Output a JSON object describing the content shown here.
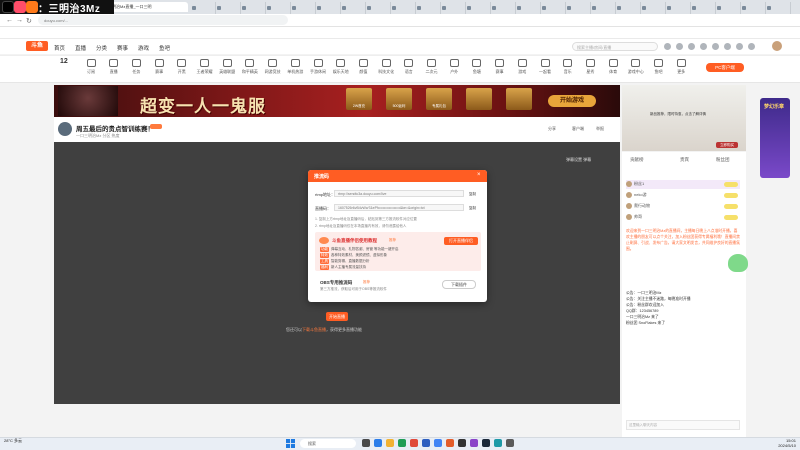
{
  "overlay": {
    "text": "：三明治3Mz"
  },
  "browser": {
    "tabs": [
      "",
      "",
      "",
      "",
      "",
      "",
      "",
      "",
      "",
      "",
      "",
      "",
      "",
      "",
      "",
      "",
      "",
      "",
      "",
      "",
      "",
      "",
      "",
      "",
      "",
      ""
    ],
    "active_tab": "一口三明治Mz直播_一口三明",
    "url": "douyu.com/..."
  },
  "site": {
    "logo": "斗鱼",
    "nav": [
      "首页",
      "直播",
      "分类",
      "赛事",
      "游戏",
      "鱼吧"
    ],
    "search_placeholder": "搜索主播/房间/直播",
    "categories": [
      "订阅",
      "直播",
      "任务",
      "赛事",
      "开黑",
      "王者荣耀",
      "英雄联盟",
      "和平精英",
      "网游竞技",
      "单机热游",
      "手游休闲",
      "娱乐天地",
      "颜值",
      "科技文化",
      "语言",
      "二次元",
      "户外",
      "鱼塘",
      "赛事",
      "游戏",
      "一起看",
      "音乐",
      "星秀",
      "体育",
      "游戏中心",
      "鱼吧",
      "更多"
    ],
    "sub_count": "12",
    "pc_button": "PC客户端"
  },
  "banner": {
    "title": "超变一人一鬼服",
    "prizes": [
      "2W首充",
      "500返利",
      "专属礼包",
      "",
      ""
    ],
    "start_button": "开始游戏"
  },
  "room": {
    "title": "周五最后的贵点智训练赛！",
    "meta": "一口三明治Mz   分区   热度",
    "buttons": [
      "分享",
      "客户端",
      "举报"
    ]
  },
  "player": {
    "tools": "弹幕设置   弹幕",
    "open_button": "开始直播",
    "hint_prefix": "您还可以",
    "hint_link": "下载斗鱼直播",
    "hint_suffix": "，获得更多直播功能"
  },
  "modal": {
    "title": "推流码",
    "rtmp_label": "rtmp地址：",
    "rtmp_value": "rtmp://sendtc3a.douyu.com/live",
    "key_label": "直播码：",
    "key_value": "1607526r6vB4vWw7&ePf••••••••••••••••••&ke=&origin=tct",
    "copy": "复制",
    "note1": "1. 复制上方rtmp地址及直播码后，粘贴到第三方推流软件对应位置",
    "note2": "2. rtmp地址及直播码仅在本场直播内有效，请勿泄露给他人",
    "promo_title": "斗鱼直播伴侣使用教程",
    "promo_tag": "推荐",
    "promo_button": "打开直播伴侣",
    "promo_lines": [
      {
        "tag": "功能",
        "text": "弹幕互动、礼物答谢、房管 等功能一键开启"
      },
      {
        "tag": "特效",
        "text": "各种特效素材、美颜滤镜、虚拟形象"
      },
      {
        "tag": "工具",
        "text": "智能剪辑、直播数据分析"
      },
      {
        "tag": "福利",
        "text": "新人主播专属流量扶持"
      }
    ],
    "obs_title": "OBS专用推流码",
    "obs_tag": "推荐",
    "obs_desc": "第三方推流，获取后可用于OBS等推流软件",
    "obs_button": "下载插件"
  },
  "ad": {
    "text": "新品推荐，限时特惠，点击了解详情",
    "button": "立即购买",
    "float": "梦幻乐章"
  },
  "chat": {
    "tabs": [
      "贡献榜",
      "贵宾",
      "粉丝团"
    ],
    "rank": [
      "粉丝1",
      "neko游",
      "爬行动物",
      "帅哥"
    ],
    "orange_text": "欢迎来到一口三明治Mz的直播间，主播每日晚上八点准时开播，喜欢主播的朋友可以点个关注，加入粉丝团获得专属福利哦！直播间禁止刷屏、引战、发布广告，请大家文明发言，共同维护良好的直播氛围。",
    "messages": [
      "公告：一口三明治Mz",
      "公告：关注主播不迷路，每晚准时开播",
      "公告：粉丝群欢迎加入",
      "QQ群：123456789",
      "一口三明治Mz  来了",
      "粉丝团  SnoFlakes  来了"
    ],
    "input_placeholder": "这里输入聊天内容"
  },
  "taskbar": {
    "weather": "28°C\n多云",
    "search": "搜索",
    "time": "15:01",
    "date": "2024/5/10"
  }
}
